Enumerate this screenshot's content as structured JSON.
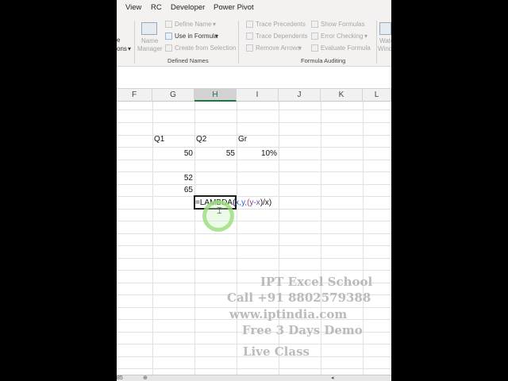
{
  "ribbon": {
    "tabs": [
      "View",
      "RC",
      "Developer",
      "Power Pivot"
    ],
    "defined_names": {
      "name_manager": [
        "Name",
        "Manager"
      ],
      "define_name": "Define Name",
      "use_in_formula": "Use in Formula",
      "create_from_selection": "Create from Selection",
      "group_label": "Defined Names"
    },
    "formula_auditing": {
      "trace_precedents": "Trace Precedents",
      "trace_dependents": "Trace Dependents",
      "remove_arrows": "Remove Arrows",
      "show_formulas": "Show Formulas",
      "error_checking": "Error Checking",
      "evaluate_formula": "Evaluate Formula",
      "group_label": "Formula Auditing"
    },
    "left_cut": [
      "e",
      "ons"
    ],
    "right_cut": [
      "Watc",
      "Wind"
    ]
  },
  "columns": [
    "F",
    "G",
    "H",
    "I",
    "J",
    "K",
    "L"
  ],
  "selected_column": "H",
  "cells": {
    "g_q1": "Q1",
    "h_q2": "Q2",
    "i_gr": "Gr",
    "g_50": "50",
    "h_55": "55",
    "i_pct": "10%",
    "g_52": "52",
    "g_65": "65"
  },
  "formula": {
    "prefix": "=LAMBDA(",
    "args1": "x,y,",
    "paren": "(",
    "inner": "y-x",
    "close": ")/x)"
  },
  "watermark": [
    "IPT Excel School",
    "Call +91 8802579388",
    "www.iptindia.com",
    "Free 3 Days Demo",
    "Live Class"
  ],
  "bottom": {
    "sheet_num": "85"
  }
}
